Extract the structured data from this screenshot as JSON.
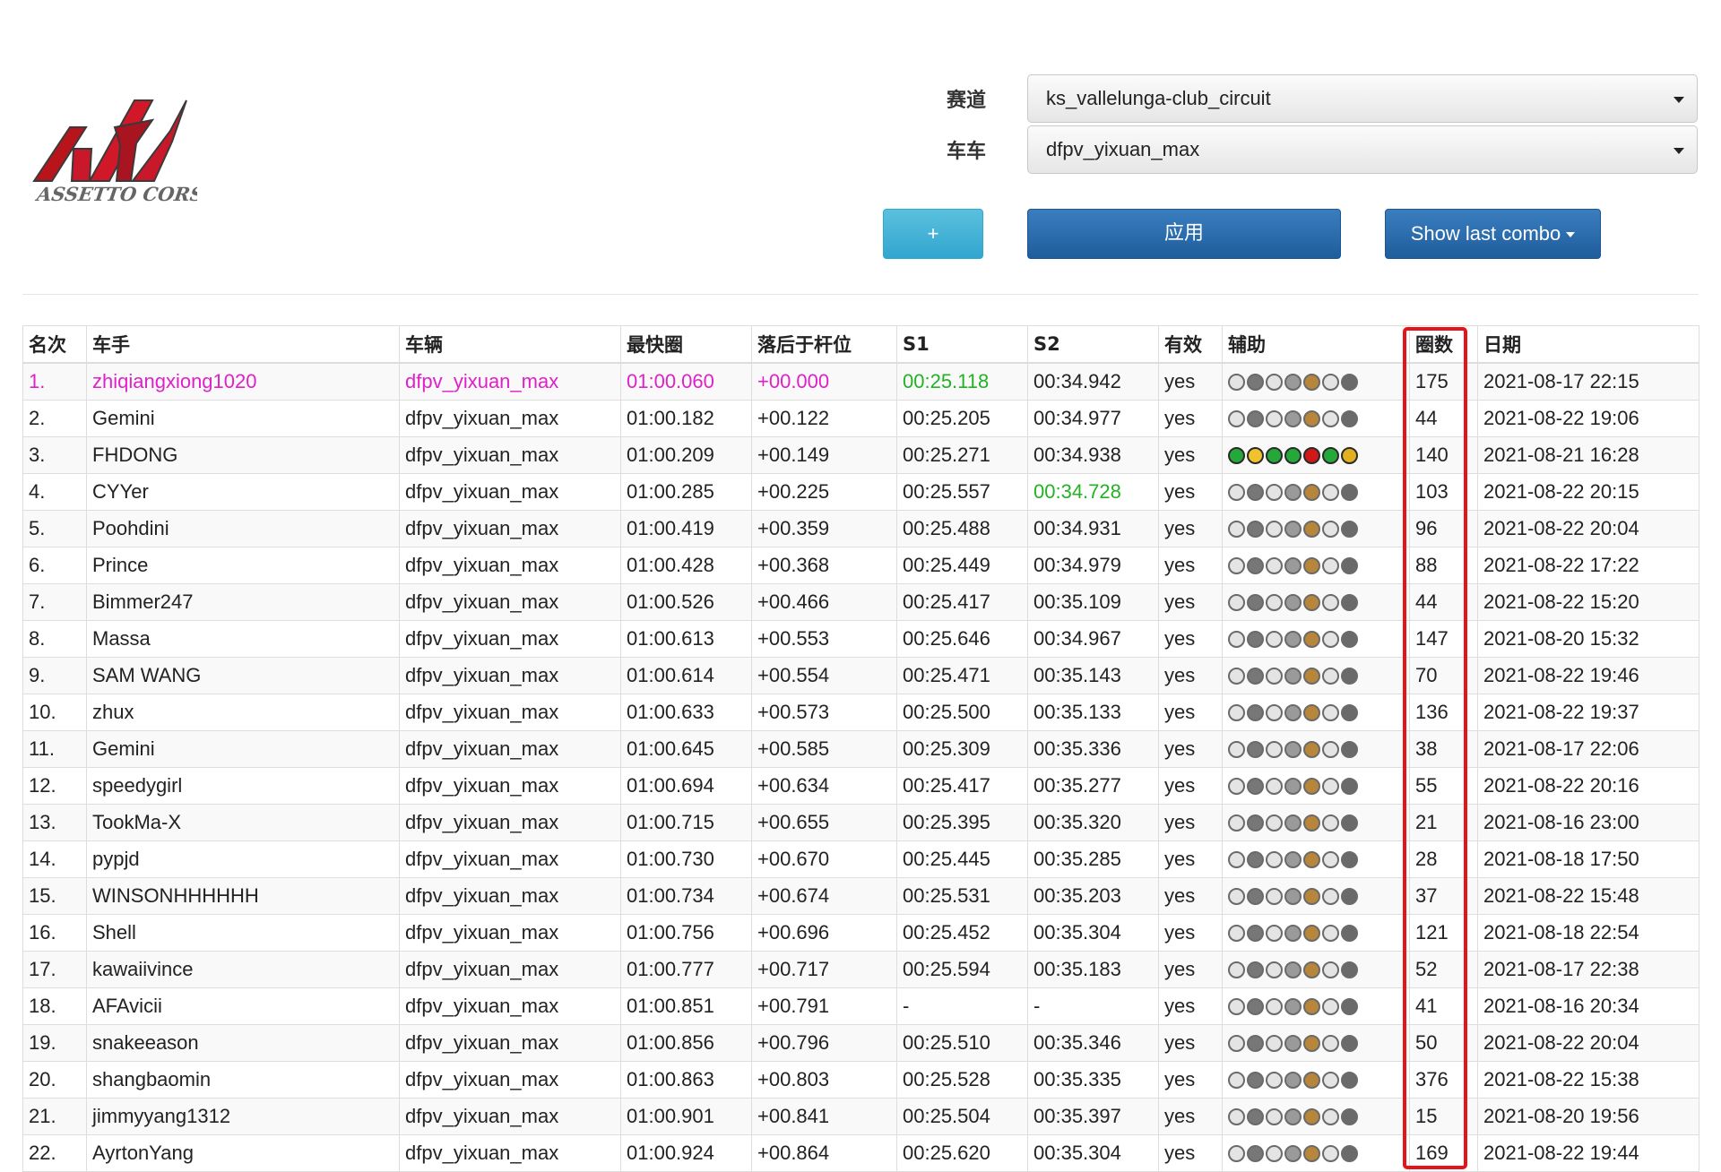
{
  "logo": {
    "text": "ASSETTO CORSA"
  },
  "filters": {
    "track_label": "赛道",
    "track_value": "ks_vallelunga-club_circuit",
    "car_label": "车车",
    "car_value": "dfpv_yixuan_max"
  },
  "buttons": {
    "add": "+",
    "apply": "应用",
    "last_combo": "Show last combo"
  },
  "table": {
    "headers": [
      "名次",
      "车手",
      "车辆",
      "最快圈",
      "落后于杆位",
      "S1",
      "S2",
      "有效",
      "辅助",
      "圈数",
      "日期"
    ],
    "rows": [
      {
        "rank": "1.",
        "driver": "zhiqiangxiong1020",
        "car": "dfpv_yixuan_max",
        "best": "01:00.060",
        "gap": "+00.000",
        "s1": "00:25.118",
        "s2": "00:34.942",
        "valid": "yes",
        "laps": "175",
        "date": "2021-08-17 22:15"
      },
      {
        "rank": "2.",
        "driver": "Gemini",
        "car": "dfpv_yixuan_max",
        "best": "01:00.182",
        "gap": "+00.122",
        "s1": "00:25.205",
        "s2": "00:34.977",
        "valid": "yes",
        "laps": "44",
        "date": "2021-08-22 19:06"
      },
      {
        "rank": "3.",
        "driver": "FHDONG",
        "car": "dfpv_yixuan_max",
        "best": "01:00.209",
        "gap": "+00.149",
        "s1": "00:25.271",
        "s2": "00:34.938",
        "valid": "yes",
        "laps": "140",
        "date": "2021-08-21 16:28"
      },
      {
        "rank": "4.",
        "driver": "CYYer",
        "car": "dfpv_yixuan_max",
        "best": "01:00.285",
        "gap": "+00.225",
        "s1": "00:25.557",
        "s2": "00:34.728",
        "valid": "yes",
        "laps": "103",
        "date": "2021-08-22 20:15"
      },
      {
        "rank": "5.",
        "driver": "Poohdini",
        "car": "dfpv_yixuan_max",
        "best": "01:00.419",
        "gap": "+00.359",
        "s1": "00:25.488",
        "s2": "00:34.931",
        "valid": "yes",
        "laps": "96",
        "date": "2021-08-22 20:04"
      },
      {
        "rank": "6.",
        "driver": "Prince",
        "car": "dfpv_yixuan_max",
        "best": "01:00.428",
        "gap": "+00.368",
        "s1": "00:25.449",
        "s2": "00:34.979",
        "valid": "yes",
        "laps": "88",
        "date": "2021-08-22 17:22"
      },
      {
        "rank": "7.",
        "driver": "Bimmer247",
        "car": "dfpv_yixuan_max",
        "best": "01:00.526",
        "gap": "+00.466",
        "s1": "00:25.417",
        "s2": "00:35.109",
        "valid": "yes",
        "laps": "44",
        "date": "2021-08-22 15:20"
      },
      {
        "rank": "8.",
        "driver": "Massa",
        "car": "dfpv_yixuan_max",
        "best": "01:00.613",
        "gap": "+00.553",
        "s1": "00:25.646",
        "s2": "00:34.967",
        "valid": "yes",
        "laps": "147",
        "date": "2021-08-20 15:32"
      },
      {
        "rank": "9.",
        "driver": "SAM WANG",
        "car": "dfpv_yixuan_max",
        "best": "01:00.614",
        "gap": "+00.554",
        "s1": "00:25.471",
        "s2": "00:35.143",
        "valid": "yes",
        "laps": "70",
        "date": "2021-08-22 19:46"
      },
      {
        "rank": "10.",
        "driver": "zhux",
        "car": "dfpv_yixuan_max",
        "best": "01:00.633",
        "gap": "+00.573",
        "s1": "00:25.500",
        "s2": "00:35.133",
        "valid": "yes",
        "laps": "136",
        "date": "2021-08-22 19:37"
      },
      {
        "rank": "11.",
        "driver": "Gemini",
        "car": "dfpv_yixuan_max",
        "best": "01:00.645",
        "gap": "+00.585",
        "s1": "00:25.309",
        "s2": "00:35.336",
        "valid": "yes",
        "laps": "38",
        "date": "2021-08-17 22:06"
      },
      {
        "rank": "12.",
        "driver": "speedygirl",
        "car": "dfpv_yixuan_max",
        "best": "01:00.694",
        "gap": "+00.634",
        "s1": "00:25.417",
        "s2": "00:35.277",
        "valid": "yes",
        "laps": "55",
        "date": "2021-08-22 20:16"
      },
      {
        "rank": "13.",
        "driver": "TookMa-X",
        "car": "dfpv_yixuan_max",
        "best": "01:00.715",
        "gap": "+00.655",
        "s1": "00:25.395",
        "s2": "00:35.320",
        "valid": "yes",
        "laps": "21",
        "date": "2021-08-16 23:00"
      },
      {
        "rank": "14.",
        "driver": "pypjd",
        "car": "dfpv_yixuan_max",
        "best": "01:00.730",
        "gap": "+00.670",
        "s1": "00:25.445",
        "s2": "00:35.285",
        "valid": "yes",
        "laps": "28",
        "date": "2021-08-18 17:50"
      },
      {
        "rank": "15.",
        "driver": "WINSONHHHHHH",
        "car": "dfpv_yixuan_max",
        "best": "01:00.734",
        "gap": "+00.674",
        "s1": "00:25.531",
        "s2": "00:35.203",
        "valid": "yes",
        "laps": "37",
        "date": "2021-08-22 15:48"
      },
      {
        "rank": "16.",
        "driver": "Shell",
        "car": "dfpv_yixuan_max",
        "best": "01:00.756",
        "gap": "+00.696",
        "s1": "00:25.452",
        "s2": "00:35.304",
        "valid": "yes",
        "laps": "121",
        "date": "2021-08-18 22:54"
      },
      {
        "rank": "17.",
        "driver": "kawaiivince",
        "car": "dfpv_yixuan_max",
        "best": "01:00.777",
        "gap": "+00.717",
        "s1": "00:25.594",
        "s2": "00:35.183",
        "valid": "yes",
        "laps": "52",
        "date": "2021-08-17 22:38"
      },
      {
        "rank": "18.",
        "driver": "AFAvicii",
        "car": "dfpv_yixuan_max",
        "best": "01:00.851",
        "gap": "+00.791",
        "s1": "-",
        "s2": "-",
        "valid": "yes",
        "laps": "41",
        "date": "2021-08-16 20:34"
      },
      {
        "rank": "19.",
        "driver": "snakeeason",
        "car": "dfpv_yixuan_max",
        "best": "01:00.856",
        "gap": "+00.796",
        "s1": "00:25.510",
        "s2": "00:35.346",
        "valid": "yes",
        "laps": "50",
        "date": "2021-08-22 20:04"
      },
      {
        "rank": "20.",
        "driver": "shangbaomin",
        "car": "dfpv_yixuan_max",
        "best": "01:00.863",
        "gap": "+00.803",
        "s1": "00:25.528",
        "s2": "00:35.335",
        "valid": "yes",
        "laps": "376",
        "date": "2021-08-22 15:38"
      },
      {
        "rank": "21.",
        "driver": "jimmyyang1312",
        "car": "dfpv_yixuan_max",
        "best": "01:00.901",
        "gap": "+00.841",
        "s1": "00:25.504",
        "s2": "00:35.397",
        "valid": "yes",
        "laps": "15",
        "date": "2021-08-20 19:56"
      },
      {
        "rank": "22.",
        "driver": "AyrtonYang",
        "car": "dfpv_yixuan_max",
        "best": "01:00.924",
        "gap": "+00.864",
        "s1": "00:25.620",
        "s2": "00:35.304",
        "valid": "yes",
        "laps": "169",
        "date": "2021-08-22 19:44"
      }
    ]
  },
  "highlights": {
    "leader_row_color": "#e020c8",
    "best_sector_color": "#22b222",
    "best_s1_row": 0,
    "best_s2_row": 3,
    "laps_column_outline": "#e5141c"
  },
  "aids_icons": {
    "names": [
      "abs-aid-icon",
      "traction-control-aid-icon",
      "stability-aid-icon",
      "autoclutch-aid-icon",
      "tyre-blankets-aid-icon",
      "ideal-line-aid-icon",
      "auto-shifter-aid-icon"
    ],
    "default_colors": [
      "#e4e4e4",
      "#777777",
      "#e4e4e4",
      "#9a9a9a",
      "#b8863a",
      "#e4e4e4",
      "#6a6a6a"
    ],
    "active_row": 2,
    "active_colors": [
      "#25a83a",
      "#f2c12e",
      "#25a83a",
      "#25a83a",
      "#d01818",
      "#25a83a",
      "#e0b020"
    ]
  }
}
